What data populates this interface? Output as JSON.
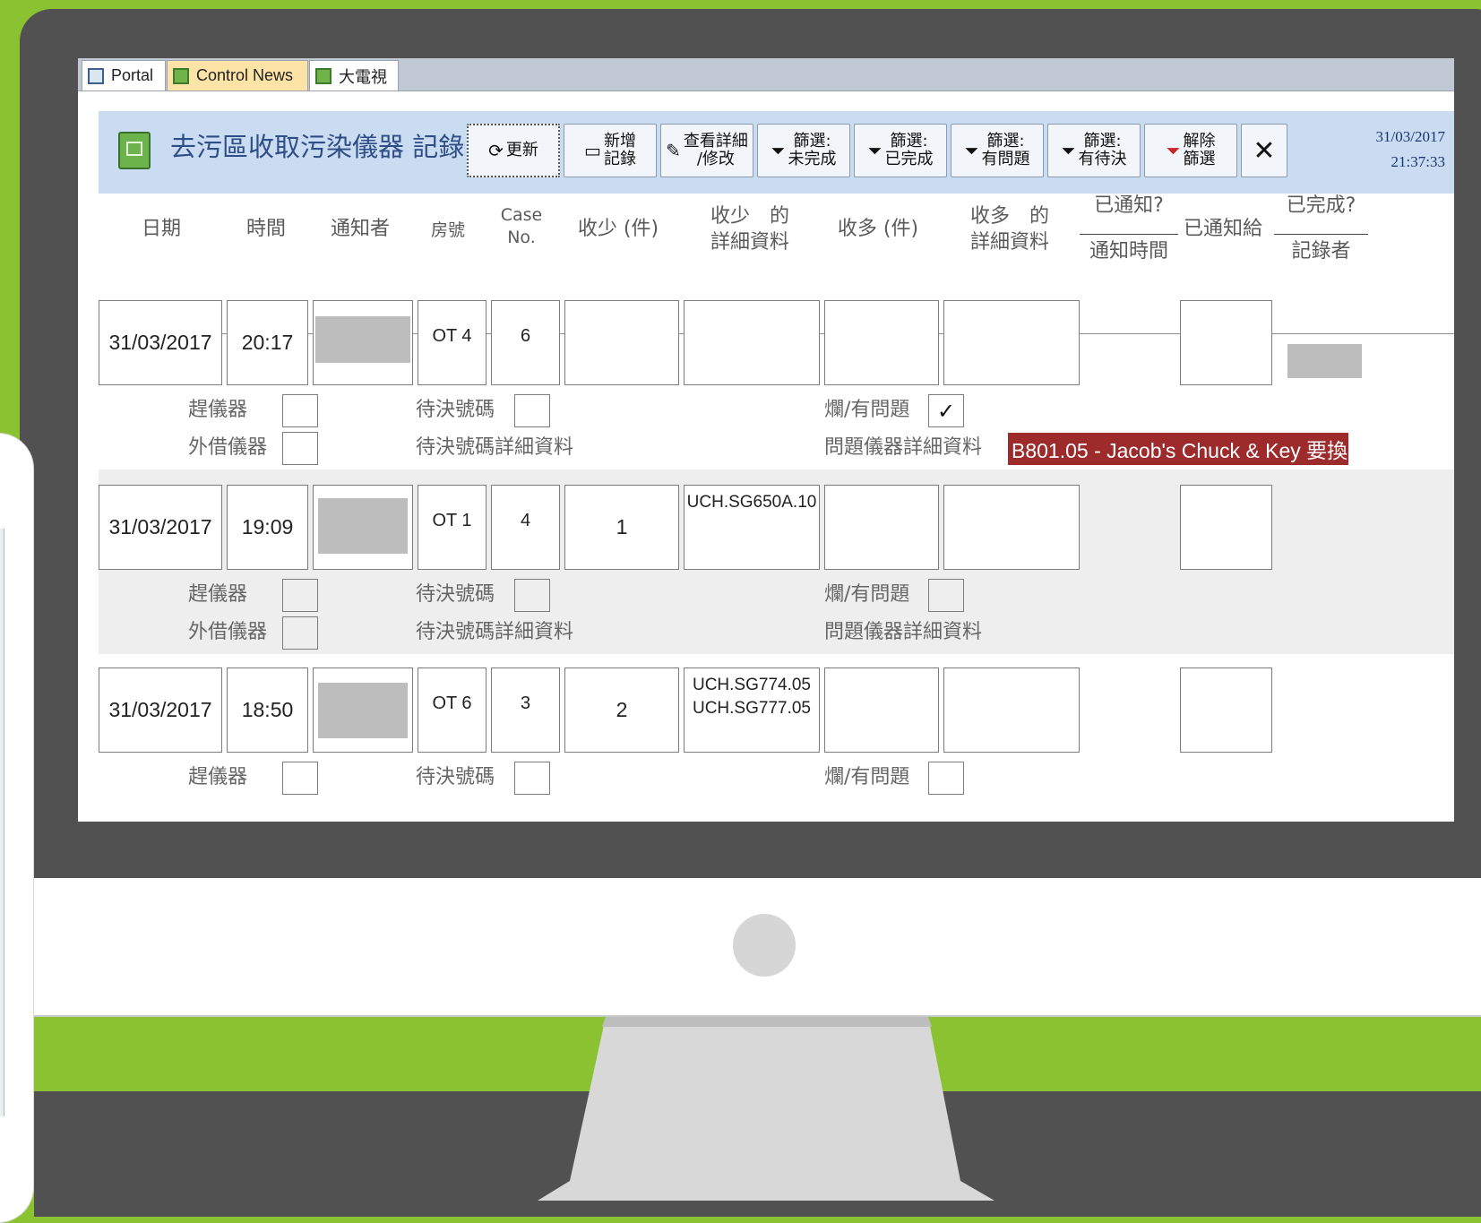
{
  "colors": {
    "background_green": "#8bc232",
    "bezel": "#515151",
    "header_blue": "#c9dcf1",
    "active_tab": "#fde4a6",
    "problem_red": "#9e2b2c"
  },
  "tabs": [
    {
      "label": "Portal",
      "icon": "form-icon"
    },
    {
      "label": "Control News",
      "icon": "form-icon"
    },
    {
      "label": "大電視",
      "icon": "form-icon"
    }
  ],
  "header": {
    "title": "去污區收取污染儀器 記錄",
    "clock_date": "31/03/2017",
    "clock_time": "21:37:33",
    "buttons": {
      "refresh": "更新",
      "new_record": "新增\n記錄",
      "view_edit": "查看詳細\n/修改",
      "filter_incomplete": "篩選:\n未完成",
      "filter_done": "篩選:\n已完成",
      "filter_problem": "篩選:\n有問題",
      "filter_pending": "篩選:\n有待決",
      "clear_filter": "解除\n篩選",
      "close": "✕"
    }
  },
  "columns": {
    "date": "日期",
    "time": "時間",
    "notifier": "通知者",
    "room": "房號",
    "case_no": "Case\nNo.",
    "less_qty": "收少 (件)",
    "less_detail": "收少　的\n詳細資料",
    "more_qty": "收多 (件)",
    "more_detail": "收多　的\n詳細資料",
    "notified": "已通知?",
    "notify_time": "通知時間",
    "notified_to": "已通知給",
    "completed": "已完成?",
    "recorder": "記錄者"
  },
  "labels": {
    "rush": "趕儀器",
    "borrowed": "外借儀器",
    "pending_no": "待決號碼",
    "pending_detail": "待決號碼詳細資料",
    "damaged": "爛/有問題",
    "problem_detail": "問題儀器詳細資料"
  },
  "records": [
    {
      "date": "31/03/2017",
      "time": "20:17",
      "room": "OT  4",
      "case_no": "6",
      "less_qty": "",
      "less_detail": "",
      "damaged_checked": "✓",
      "problem_detail": "B801.05 - Jacob's Chuck & Key  要換"
    },
    {
      "date": "31/03/2017",
      "time": "19:09",
      "room": "OT  1",
      "case_no": "4",
      "less_qty": "1",
      "less_detail": "UCH.SG650A.10",
      "damaged_checked": "",
      "problem_detail": ""
    },
    {
      "date": "31/03/2017",
      "time": "18:50",
      "room": "OT  6",
      "case_no": "3",
      "less_qty": "2",
      "less_detail": "UCH.SG774.05\nUCH.SG777.05",
      "damaged_checked": "",
      "problem_detail": ""
    }
  ]
}
